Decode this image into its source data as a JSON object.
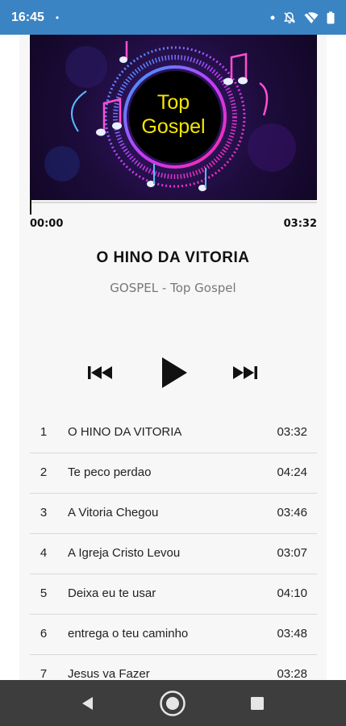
{
  "status": {
    "time": "16:45",
    "dot": "•"
  },
  "artwork": {
    "line1": "Top",
    "line2": "Gospel"
  },
  "player": {
    "elapsed": "00:00",
    "duration": "03:32",
    "progress": 0.0,
    "title": "O HINO DA VITORIA",
    "subtitle": "GOSPEL - Top Gospel"
  },
  "tracks": [
    {
      "num": "1",
      "name": "O HINO DA VITORIA",
      "duration": "03:32"
    },
    {
      "num": "2",
      "name": "Te peco perdao",
      "duration": "04:24"
    },
    {
      "num": "3",
      "name": "A Vitoria Chegou",
      "duration": "03:46"
    },
    {
      "num": "4",
      "name": "A Igreja Cristo Levou",
      "duration": "03:07"
    },
    {
      "num": "5",
      "name": "Deixa eu te usar",
      "duration": "04:10"
    },
    {
      "num": "6",
      "name": "entrega o teu caminho",
      "duration": "03:48"
    },
    {
      "num": "7",
      "name": "Jesus va Fazer",
      "duration": "03:28"
    }
  ],
  "colors": {
    "status_bar": "#3b84c4",
    "nav_bar": "#3d3d3d",
    "art_text": "#f5e600"
  }
}
